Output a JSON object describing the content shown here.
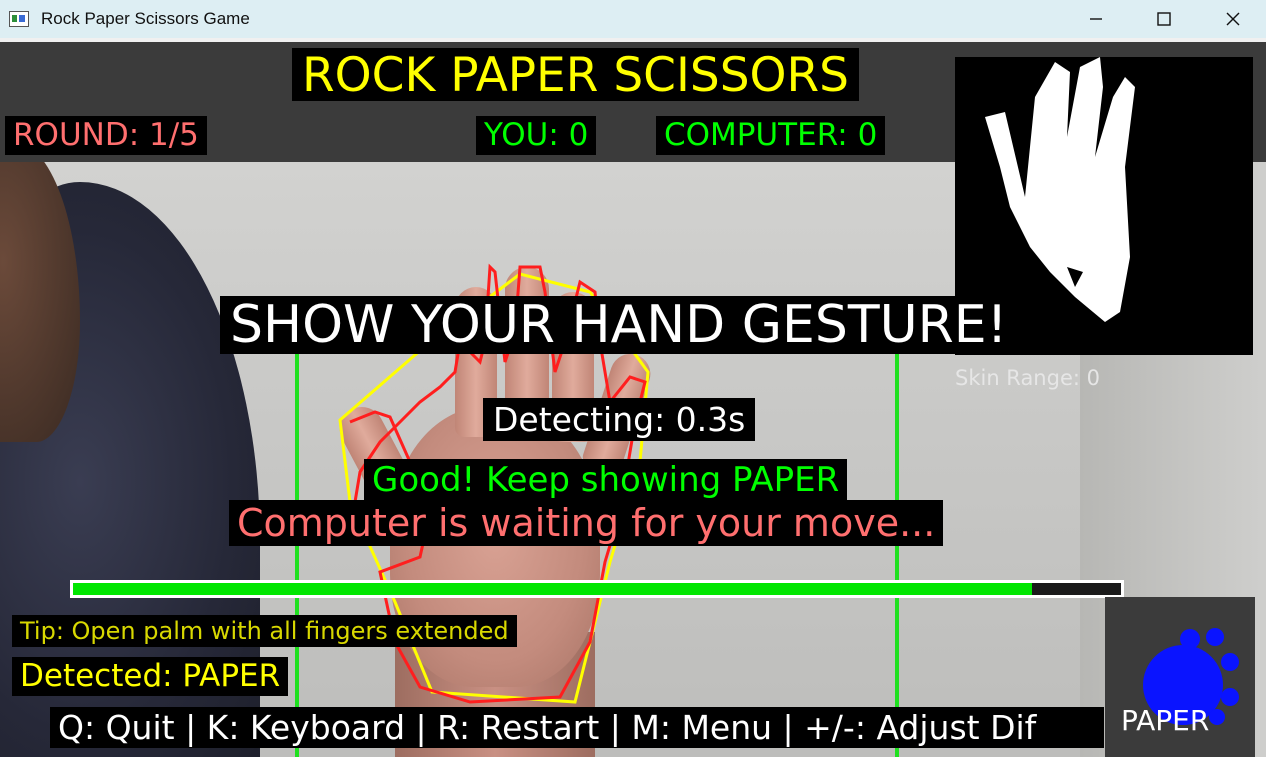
{
  "window": {
    "title": "Rock Paper Scissors Game",
    "minimize_label": "—",
    "maximize_label": "☐",
    "close_label": "✕"
  },
  "header": {
    "title": "ROCK PAPER SCISSORS",
    "round": "ROUND: 1/5",
    "you_score": "YOU: 0",
    "computer_score": "COMPUTER: 0"
  },
  "game": {
    "prompt": "SHOW YOUR HAND GESTURE!",
    "detecting": "Detecting: 0.3s",
    "feedback": "Good! Keep showing PAPER",
    "computer_status": "Computer is waiting for your move...",
    "skin_range": "Skin Range: 0",
    "tip": "Tip: Open palm with all fingers extended",
    "detected": "Detected: PAPER",
    "progress": 0.915,
    "gesture_icon_label": "PAPER"
  },
  "footer": {
    "controls": "Q: Quit | K: Keyboard | R: Restart | M: Menu | +/-: Adjust Dif"
  },
  "colors": {
    "yellow": "#ffff00",
    "green": "#00ff00",
    "salmon": "#ff6f6f",
    "white": "#ffffff",
    "blue": "#0a14ff"
  },
  "icons": [
    "app-icon",
    "minimize-icon",
    "maximize-icon",
    "close-icon",
    "paper-gesture-icon"
  ]
}
